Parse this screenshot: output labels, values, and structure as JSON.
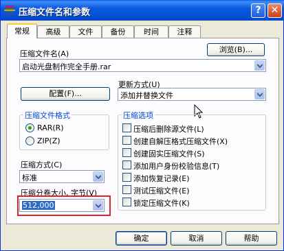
{
  "window": {
    "title": "压缩文件名和参数"
  },
  "titlebar_buttons": {
    "help": "?",
    "close": "✕"
  },
  "tabs": [
    {
      "label": "常规"
    },
    {
      "label": "高级"
    },
    {
      "label": "文件"
    },
    {
      "label": "备份"
    },
    {
      "label": "时间"
    },
    {
      "label": "注释"
    }
  ],
  "archive_name": {
    "label": "压缩文件名(A)",
    "value": "启动光盘制作完全手册.rar",
    "browse_label": "浏览(B)..."
  },
  "update_mode": {
    "label": "更新方式(U)",
    "value": "添加并替换文件"
  },
  "config_button": "配置(F)...",
  "format_group": {
    "title": "压缩文件格式",
    "options": [
      {
        "label": "RAR(R)",
        "selected": true
      },
      {
        "label": "ZIP(Z)",
        "selected": false
      }
    ]
  },
  "compression_method": {
    "label": "压缩方式(C)",
    "value": "标准"
  },
  "split_volume": {
    "label": "压缩分卷大小, 字节(V)",
    "value": "512,000"
  },
  "options_group": {
    "title": "压缩选项",
    "items": [
      {
        "label": "压缩后删除源文件(L)",
        "checked": false
      },
      {
        "label": "创建自解压格式压缩文件(X)",
        "checked": false
      },
      {
        "label": "创建固实压缩文件(S)",
        "checked": false
      },
      {
        "label": "添加用户身份校验信息(T)",
        "checked": false
      },
      {
        "label": "添加恢复记录(E)",
        "checked": false
      },
      {
        "label": "测试压缩文件(E)",
        "checked": false
      },
      {
        "label": "锁定压缩文件(K)",
        "checked": false
      }
    ]
  },
  "footer": {
    "ok": "确定",
    "cancel": "取消",
    "help": "帮助"
  },
  "colors": {
    "titlebar": "#0653d6",
    "group_title": "#0046d5",
    "highlight": "#e0202a",
    "selection": "#316ac5"
  }
}
